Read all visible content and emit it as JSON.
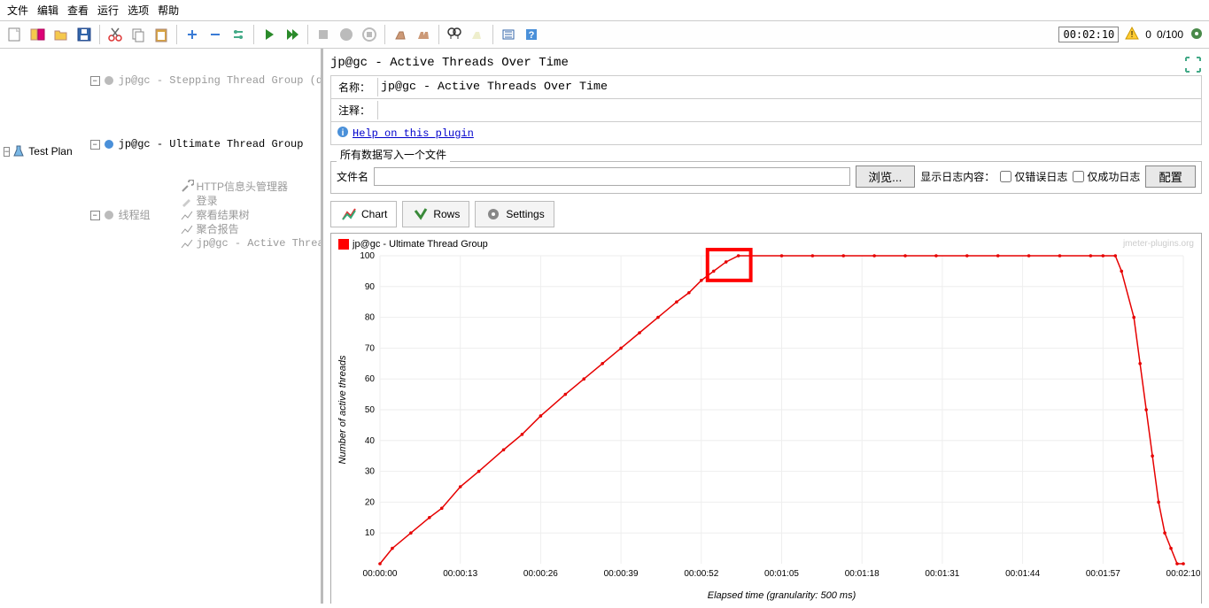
{
  "menu": {
    "file": "文件",
    "edit": "编辑",
    "search": "查看",
    "run": "运行",
    "options": "选项",
    "help": "帮助"
  },
  "toolbar": {
    "time": "00:02:10",
    "threads": "0",
    "total_threads": "0/100",
    "errors": "0"
  },
  "tree": {
    "root": "Test Plan",
    "stepping": "jp@gc - Stepping Thread Group (deprecated)",
    "http_header": "HTTP信息头管理器",
    "login": "登录",
    "view_results": "察看结果树",
    "aggregate": "聚合报告",
    "ultimate": "jp@gc - Ultimate Thread Group",
    "active_threads": "jp@gc - Active Threads Over Time",
    "thread_group": "线程组"
  },
  "panel": {
    "title": "jp@gc - Active Threads Over Time",
    "name_label": "名称：",
    "name_value": "jp@gc - Active Threads Over Time",
    "comment_label": "注释：",
    "help_link": "Help on this plugin",
    "file_group_title": "所有数据写入一个文件",
    "filename_label": "文件名",
    "browse": "浏览...",
    "log_display": "显示日志内容：",
    "errors_only": "仅错误日志",
    "success_only": "仅成功日志",
    "configure": "配置"
  },
  "tabs": {
    "chart": "Chart",
    "rows": "Rows",
    "settings": "Settings"
  },
  "chart_data": {
    "type": "line",
    "title": "",
    "legend": "jp@gc - Ultimate Thread Group",
    "watermark": "jmeter-plugins.org",
    "ylabel": "Number of active threads",
    "xlabel": "Elapsed time (granularity: 500 ms)",
    "ylim": [
      0,
      100
    ],
    "xlim": [
      0,
      130
    ],
    "x_ticks": [
      "00:00:00",
      "00:00:13",
      "00:00:26",
      "00:00:39",
      "00:00:52",
      "00:01:05",
      "00:01:18",
      "00:01:31",
      "00:01:44",
      "00:01:57",
      "00:02:10"
    ],
    "y_ticks": [
      10,
      20,
      30,
      40,
      50,
      60,
      70,
      80,
      90,
      100
    ],
    "series": [
      {
        "name": "jp@gc - Ultimate Thread Group",
        "points": [
          [
            0,
            0
          ],
          [
            2,
            5
          ],
          [
            5,
            10
          ],
          [
            8,
            15
          ],
          [
            10,
            18
          ],
          [
            13,
            25
          ],
          [
            16,
            30
          ],
          [
            20,
            37
          ],
          [
            23,
            42
          ],
          [
            26,
            48
          ],
          [
            30,
            55
          ],
          [
            33,
            60
          ],
          [
            36,
            65
          ],
          [
            39,
            70
          ],
          [
            42,
            75
          ],
          [
            45,
            80
          ],
          [
            48,
            85
          ],
          [
            50,
            88
          ],
          [
            52,
            92
          ],
          [
            54,
            95
          ],
          [
            56,
            98
          ],
          [
            58,
            100
          ],
          [
            60,
            100
          ],
          [
            65,
            100
          ],
          [
            70,
            100
          ],
          [
            75,
            100
          ],
          [
            80,
            100
          ],
          [
            85,
            100
          ],
          [
            90,
            100
          ],
          [
            95,
            100
          ],
          [
            100,
            100
          ],
          [
            105,
            100
          ],
          [
            110,
            100
          ],
          [
            115,
            100
          ],
          [
            117,
            100
          ],
          [
            119,
            100
          ],
          [
            120,
            95
          ],
          [
            122,
            80
          ],
          [
            123,
            65
          ],
          [
            124,
            50
          ],
          [
            125,
            35
          ],
          [
            126,
            20
          ],
          [
            127,
            10
          ],
          [
            128,
            5
          ],
          [
            129,
            0
          ],
          [
            130,
            0
          ]
        ]
      }
    ],
    "highlight_box": {
      "x1": 53,
      "x2": 60,
      "y1": 92,
      "y2": 102
    }
  }
}
